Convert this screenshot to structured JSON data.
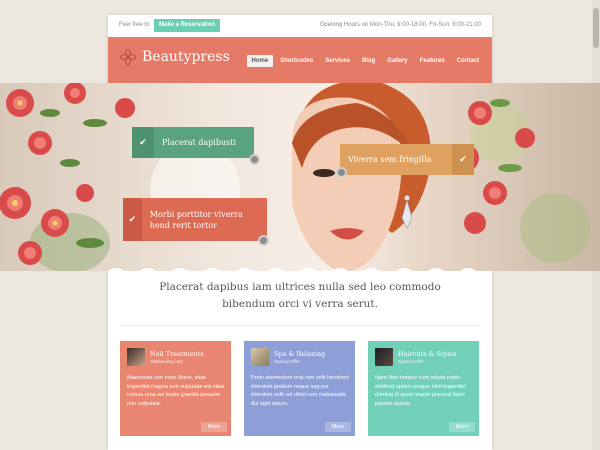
{
  "topbar": {
    "intro": "Feel free to",
    "reserve_label": "Make a Reservation",
    "hours": "Opening Hours on Mon-Thu: 9:00-18:00, Fri-Sun: 9:00-21:00"
  },
  "header": {
    "logo": "Beautypress",
    "nav": [
      "Home",
      "Shortcodes",
      "Services",
      "Blog",
      "Gallery",
      "Features",
      "Contact"
    ],
    "active_nav": "Home"
  },
  "hero": {
    "callouts": [
      {
        "text": "Placerat dapibusti",
        "color": "#5aa381"
      },
      {
        "text": "Viverra sem fringilla",
        "color": "#dea15f"
      },
      {
        "text": "Morbi porttitor viverra hend rerit tortor",
        "color": "#dd6a53"
      }
    ]
  },
  "headline": "Placerat dapibus iam ultrices nulla sed leo commodo bibendum orci vi verra serut.",
  "cards": [
    {
      "title": "Nail Treatments",
      "subtitle": "Subheading text",
      "body": "Maecenas non nunc libero, vitae imperdiet magna non vulputate est vitae cursus urna vel turpis gravida posuere non vulputate.",
      "more": "More",
      "color": "#e98672"
    },
    {
      "title": "Spa & Relaxing",
      "subtitle": "Special Offer",
      "body": "Proin elementum erat non velit hendrerit interdum pretium neque sag por interdum velit vel ultrici non malesuada dui eget ipsum.",
      "more": "More",
      "color": "#8e9fd8"
    },
    {
      "title": "Haircuts & Styles",
      "subtitle": "Special Offer",
      "body": "Nam liber tempor cum soluta nobis eleifend option congue nihil imperdiet doming id quod mazim placerat facer possim assum.",
      "more": "More",
      "color": "#72d0b8"
    }
  ]
}
